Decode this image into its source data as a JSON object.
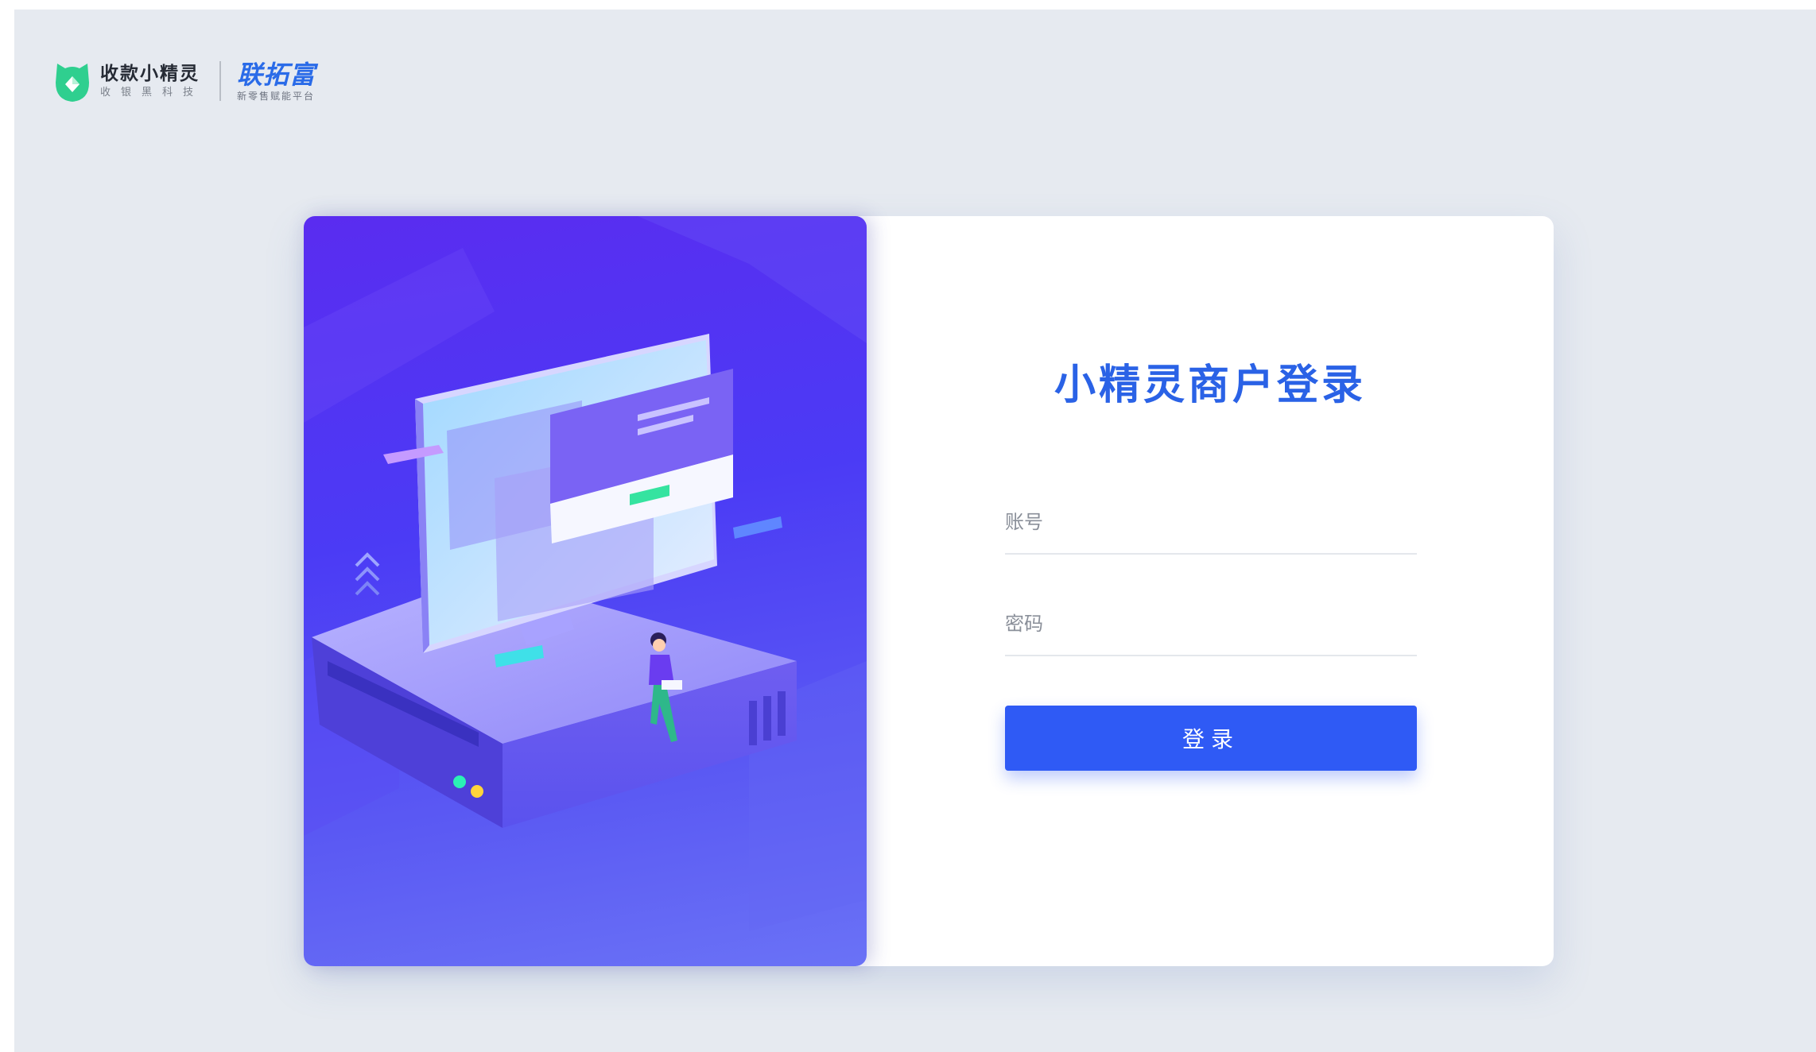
{
  "brand": {
    "title": "收款小精灵",
    "subtitle": "收银黑科技",
    "partner_title": "联拓富",
    "partner_subtitle": "新零售赋能平台",
    "logo_color": "#2fcf8f"
  },
  "login": {
    "title": "小精灵商户登录",
    "account_placeholder": "账号",
    "password_placeholder": "密码",
    "submit_label": "登录"
  },
  "colors": {
    "accent": "#2f5af5",
    "title": "#2a62e6",
    "background": "#e6eaf0"
  }
}
